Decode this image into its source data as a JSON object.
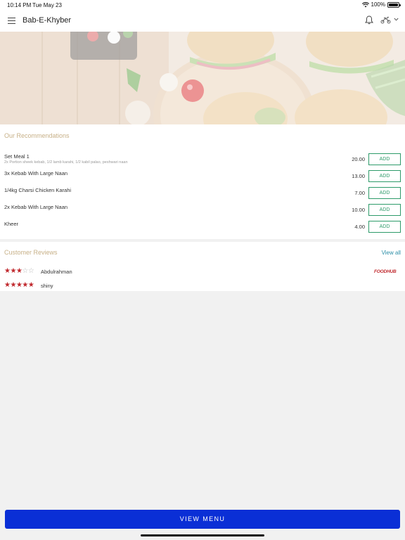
{
  "status_bar": {
    "time": "10:14 PM",
    "date": "Tue May 23",
    "battery": "100%"
  },
  "header": {
    "title": "Bab-E-Khyber",
    "icons": [
      "menu-icon",
      "bell-icon",
      "scooter-icon",
      "chevron-down-icon"
    ]
  },
  "recommendations": {
    "title": "Our Recommendations",
    "items": [
      {
        "name": "Set Meal 1",
        "description": "2x Portion sheek kebab, 1/2 lamb karahi, 1/2 kabil palao, peshwari naan",
        "price": "20.00",
        "button": "ADD"
      },
      {
        "name": "3x Kebab With Large Naan",
        "description": "",
        "price": "13.00",
        "button": "ADD"
      },
      {
        "name": "1/4kg Charsi Chicken Karahi",
        "description": "",
        "price": "7.00",
        "button": "ADD"
      },
      {
        "name": "2x Kebab With Large Naan",
        "description": "",
        "price": "10.00",
        "button": "ADD"
      },
      {
        "name": "Kheer",
        "description": "",
        "price": "4.00",
        "button": "ADD"
      }
    ]
  },
  "reviews": {
    "title": "Customer Reviews",
    "view_all": "View all",
    "source_logo": "FOODHUB",
    "items": [
      {
        "name": "Abdulrahman",
        "rating": 3
      },
      {
        "name": "shiny",
        "rating": 5
      }
    ]
  },
  "footer": {
    "button": "VIEW MENU"
  },
  "colors": {
    "accent_gold": "#c7b087",
    "add_green": "#2e9b6a",
    "primary_blue": "#0a2fd6",
    "star_red": "#c0282d",
    "link_blue": "#2d8fa8"
  }
}
